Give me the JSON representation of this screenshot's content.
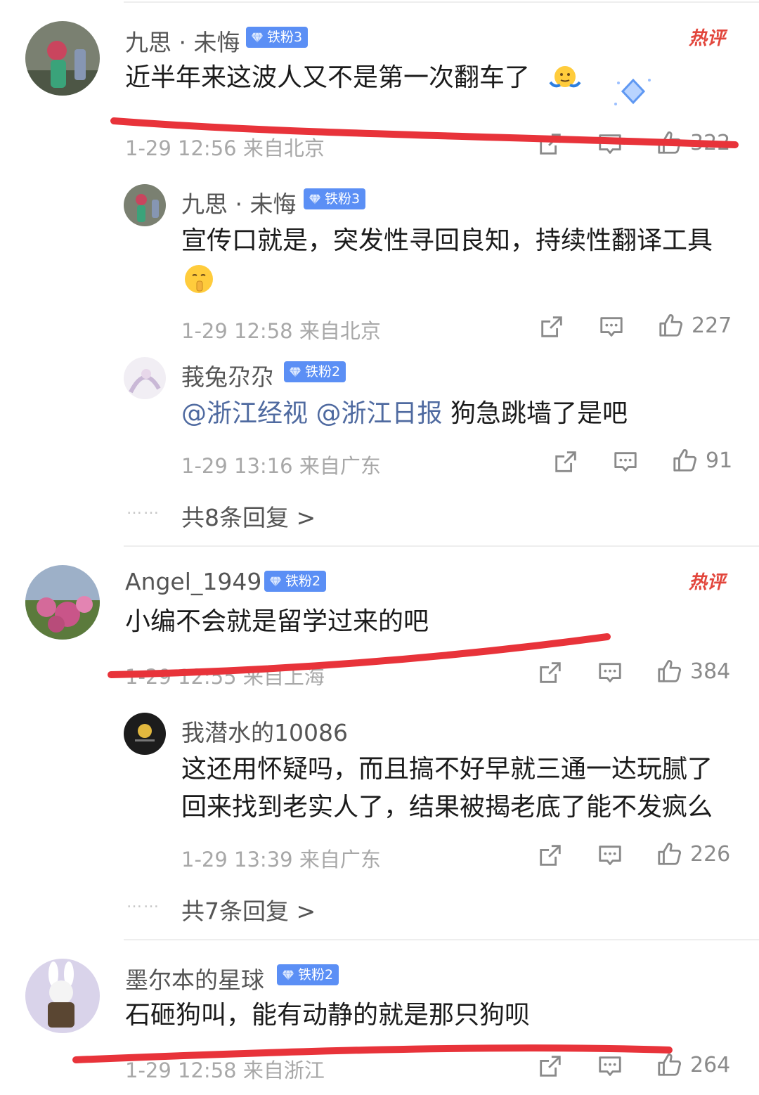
{
  "comments": [
    {
      "user": "九思 · 未悔",
      "badge": "铁粉3",
      "hot_tag": "热评",
      "text": "近半年来这波人又不是第一次翻车了",
      "meta": "1-29 12:56  来自北京",
      "likes": "322",
      "replies": [
        {
          "user": "九思 · 未悔",
          "badge": "铁粉3",
          "text": "宣传口就是，突发性寻回良知，持续性翻译工具",
          "meta": "1-29 12:58  来自北京",
          "likes": "227"
        },
        {
          "user": "莪兔尕尕",
          "badge": "铁粉2",
          "mention1": "@浙江经视",
          "mention2": "@浙江日报",
          "text": "狗急跳墙了是吧",
          "meta": "1-29 13:16  来自广东",
          "likes": "91"
        }
      ],
      "more_replies": "共8条回复 >"
    },
    {
      "user": "Angel_1949",
      "badge": "铁粉2",
      "hot_tag": "热评",
      "text": "小编不会就是留学过来的吧",
      "meta": "1-29 12:55  来自上海",
      "likes": "384",
      "replies": [
        {
          "user": "我潜水的10086",
          "text_line1": "这还用怀疑吗，而且搞不好早就三通一达玩腻了",
          "text_line2": "回来找到老实人了，结果被揭老底了能不发疯么",
          "meta": "1-29 13:39  来自广东",
          "likes": "226"
        }
      ],
      "more_replies": "共7条回复 >"
    },
    {
      "user": "墨尔本的星球",
      "badge": "铁粉2",
      "text": "石砸狗叫，能有动静的就是那只狗呗",
      "meta": "1-29 12:58  来自浙江",
      "likes": "264"
    }
  ],
  "ellipsis": "……",
  "colors": {
    "badge": "#5b8ff5",
    "hot": "#e2463c",
    "marker": "#e8333a",
    "meta": "#a8a8a8"
  },
  "icons": [
    "share-icon",
    "comment-icon",
    "like-icon",
    "gem-icon"
  ]
}
